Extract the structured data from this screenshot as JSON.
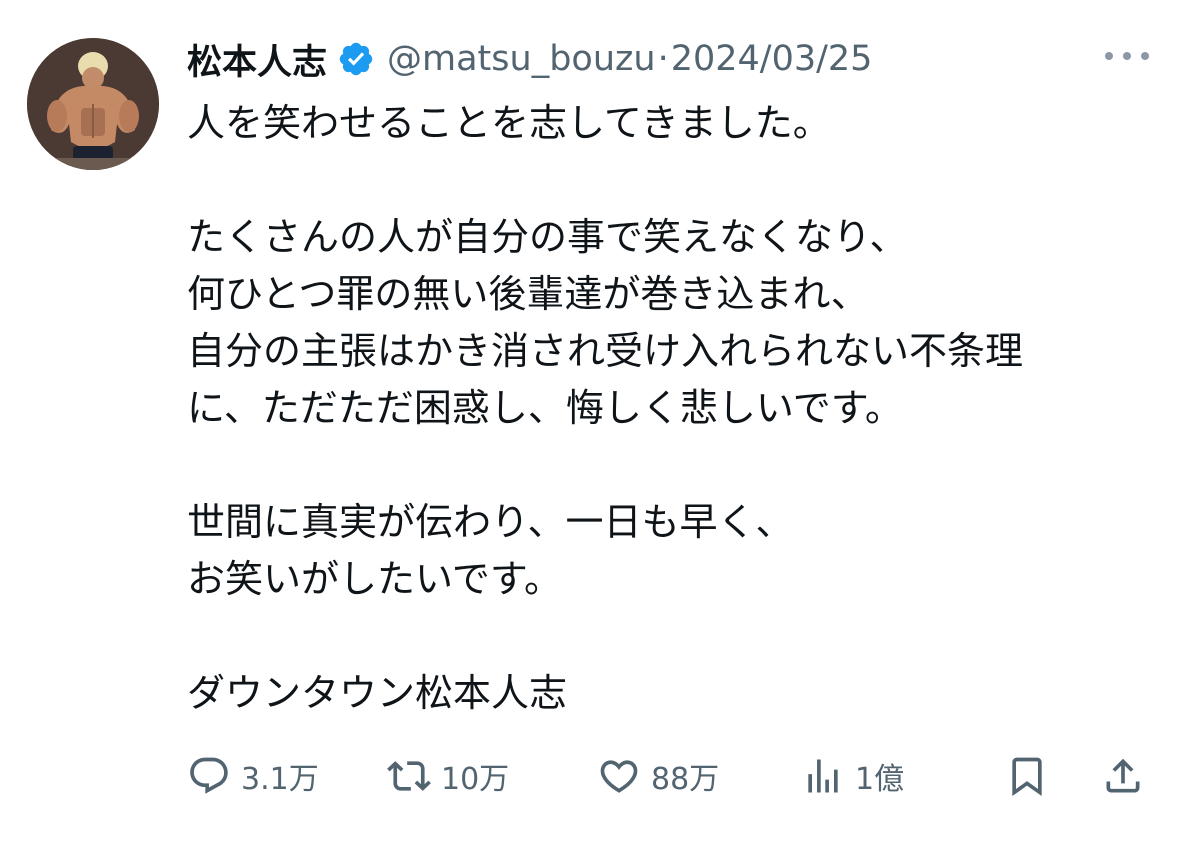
{
  "author": {
    "name": "松本人志",
    "handle": "@matsu_bouzu",
    "separator": "·",
    "date": "2024/03/25"
  },
  "tweet": {
    "text": "人を笑わせることを志してきました。\n\nたくさんの人が自分の事で笑えなくなり、\n何ひとつ罪の無い後輩達が巻き込まれ、\n自分の主張はかき消され受け入れられない不条理\nに、ただただ困惑し、悔しく悲しいです。\n\n世間に真実が伝わり、一日も早く、\nお笑いがしたいです。\n\nダウンタウン松本人志"
  },
  "actions": {
    "replies": "3.1万",
    "reposts": "10万",
    "likes": "88万",
    "views": "1億"
  },
  "icons": {
    "verified": "verified-badge-icon",
    "more": "more-icon",
    "reply": "reply-icon",
    "repost": "repost-icon",
    "like": "like-icon",
    "views": "views-icon",
    "bookmark": "bookmark-icon",
    "share": "share-icon"
  },
  "colors": {
    "verified": "#1d9bf0",
    "text": "#0f1419",
    "secondary": "#536471"
  }
}
